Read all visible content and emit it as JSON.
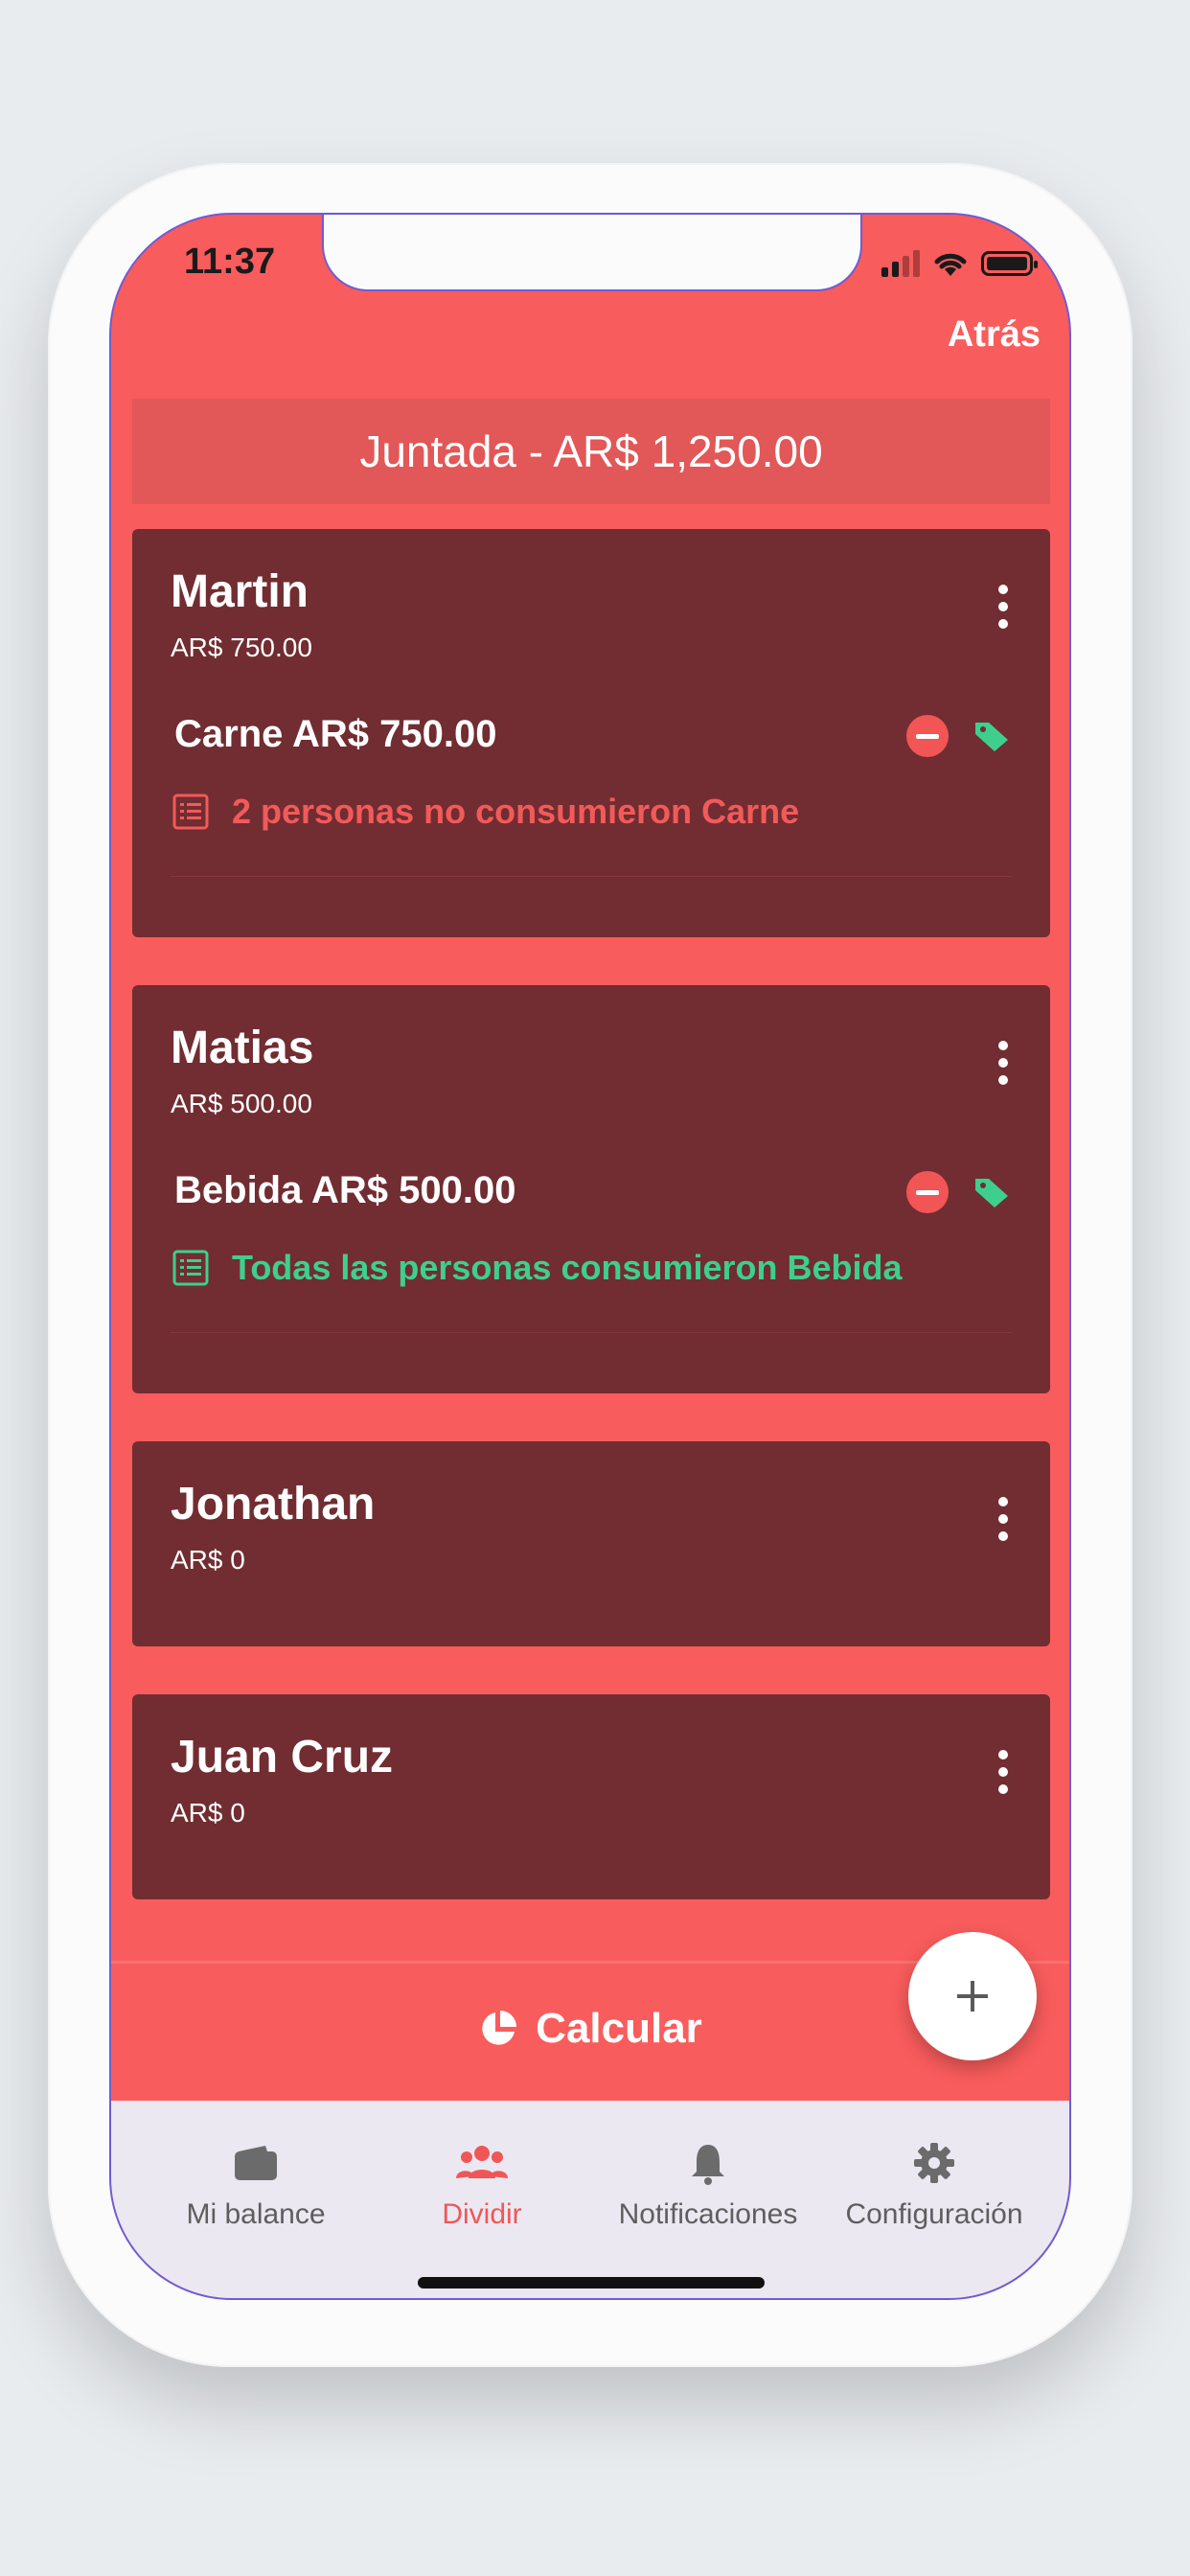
{
  "status": {
    "time": "11:37"
  },
  "header": {
    "back_label": "Atrás"
  },
  "banner": {
    "text": "Juntada - AR$ 1,250.00"
  },
  "people": [
    {
      "name": "Martin",
      "amount": "AR$ 750.00",
      "item": "Carne AR$ 750.00",
      "note": "2 personas no consumieron Carne",
      "note_color": "#f25a5a"
    },
    {
      "name": "Matias",
      "amount": "AR$ 500.00",
      "item": "Bebida AR$ 500.00",
      "note": "Todas las personas consumieron Bebida",
      "note_color": "#3ecf8e"
    },
    {
      "name": "Jonathan",
      "amount": "AR$ 0"
    },
    {
      "name": "Juan Cruz",
      "amount": "AR$ 0"
    }
  ],
  "actions": {
    "calculate_label": "Calcular",
    "fab_icon": "plus-icon"
  },
  "tabs": [
    {
      "label": "Mi balance",
      "icon": "wallet-icon"
    },
    {
      "label": "Dividir",
      "icon": "group-icon",
      "active": true
    },
    {
      "label": "Notificaciones",
      "icon": "bell-icon"
    },
    {
      "label": "Configuración",
      "icon": "gear-icon"
    }
  ],
  "colors": {
    "accent": "#f95c5c",
    "card": "#712d31",
    "tag": "#3ecf8e",
    "active_tab": "#ef5757"
  }
}
